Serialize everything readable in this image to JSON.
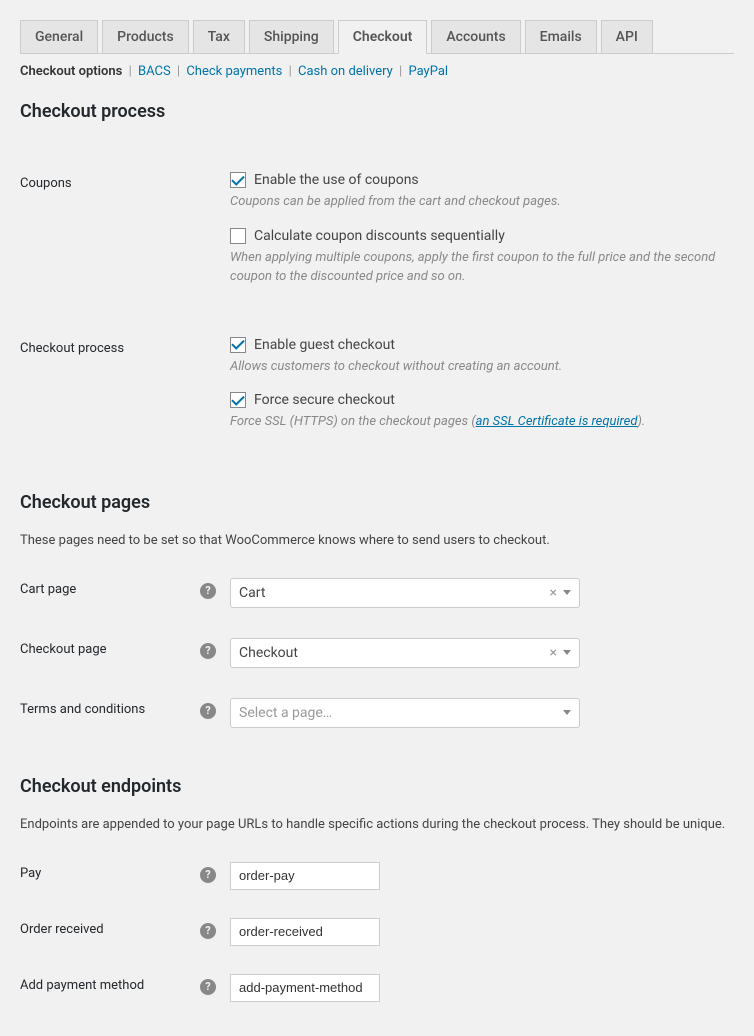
{
  "tabs": {
    "items": [
      {
        "label": "General"
      },
      {
        "label": "Products"
      },
      {
        "label": "Tax"
      },
      {
        "label": "Shipping"
      },
      {
        "label": "Checkout",
        "active": true
      },
      {
        "label": "Accounts"
      },
      {
        "label": "Emails"
      },
      {
        "label": "API"
      }
    ]
  },
  "subnav": {
    "current": "Checkout options",
    "links": [
      "BACS",
      "Check payments",
      "Cash on delivery",
      "PayPal"
    ]
  },
  "sections": {
    "process": {
      "heading": "Checkout process",
      "coupons_label": "Coupons",
      "enable_coupons_label": "Enable the use of coupons",
      "enable_coupons_desc": "Coupons can be applied from the cart and checkout pages.",
      "sequential_label": "Calculate coupon discounts sequentially",
      "sequential_desc": "When applying multiple coupons, apply the first coupon to the full price and the second coupon to the discounted price and so on.",
      "checkout_process_label": "Checkout process",
      "guest_label": "Enable guest checkout",
      "guest_desc": "Allows customers to checkout without creating an account.",
      "secure_label": "Force secure checkout",
      "secure_desc_pre": "Force SSL (HTTPS) on the checkout pages (",
      "secure_link": "an SSL Certificate is required",
      "secure_desc_post": ")."
    },
    "pages": {
      "heading": "Checkout pages",
      "sub": "These pages need to be set so that WooCommerce knows where to send users to checkout.",
      "cart_label": "Cart page",
      "cart_value": "Cart",
      "checkout_label": "Checkout page",
      "checkout_value": "Checkout",
      "terms_label": "Terms and conditions",
      "terms_placeholder": "Select a page…"
    },
    "endpoints": {
      "heading": "Checkout endpoints",
      "sub": "Endpoints are appended to your page URLs to handle specific actions during the checkout process. They should be unique.",
      "pay_label": "Pay",
      "pay_value": "order-pay",
      "received_label": "Order received",
      "received_value": "order-received",
      "addpm_label": "Add payment method",
      "addpm_value": "add-payment-method"
    }
  }
}
